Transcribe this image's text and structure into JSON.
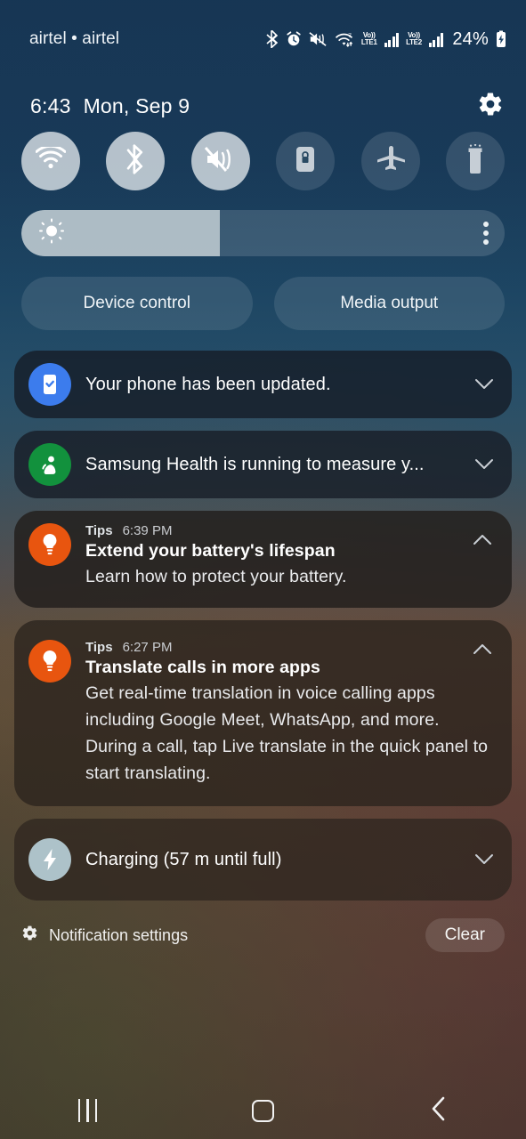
{
  "status_bar": {
    "carrier": "airtel • airtel",
    "battery_percent": "24%",
    "icons": [
      "bluetooth-icon",
      "alarm-icon",
      "mute-vibrate-icon",
      "wifi-icon",
      "volte1-icon",
      "signal-bars-1-icon",
      "volte2-icon",
      "signal-bars-2-icon",
      "battery-charging-icon"
    ],
    "wifi_badge": "7",
    "volte1_top": "Vo))",
    "volte1_bottom": "LTE1",
    "volte2_top": "Vo))",
    "volte2_bottom": "LTE2"
  },
  "header": {
    "time": "6:43",
    "date": "Mon, Sep 9",
    "settings_icon": "gear-icon"
  },
  "quick_toggles": [
    {
      "name": "wifi",
      "label": "Wi-Fi",
      "icon": "wifi-icon",
      "state": "on"
    },
    {
      "name": "bluetooth",
      "label": "Bluetooth",
      "icon": "bluetooth-icon",
      "state": "on"
    },
    {
      "name": "sound-mode",
      "label": "Vibrate",
      "icon": "mute-vibrate-icon",
      "state": "on"
    },
    {
      "name": "auto-rotate",
      "label": "Auto rotate",
      "icon": "rotation-lock-icon",
      "state": "off"
    },
    {
      "name": "airplane-mode",
      "label": "Airplane mode",
      "icon": "airplane-icon",
      "state": "off"
    },
    {
      "name": "flashlight",
      "label": "Flashlight",
      "icon": "flashlight-icon",
      "state": "off"
    }
  ],
  "brightness": {
    "icon": "sun-icon",
    "level_percent": 41,
    "menu_icon": "more-vertical-icon"
  },
  "panel_buttons": {
    "device_control": "Device control",
    "media_output": "Media output"
  },
  "notifications": [
    {
      "app_icon": "software-update-icon",
      "title": "Your phone has been updated.",
      "expanded": false,
      "chevron": "chevron-down-icon"
    },
    {
      "app_icon": "samsung-health-icon",
      "title": "Samsung Health is running to measure y...",
      "expanded": false,
      "chevron": "chevron-down-icon"
    },
    {
      "app_icon": "tips-bulb-icon",
      "app_name": "Tips",
      "time": "6:39 PM",
      "heading": "Extend your battery's lifespan",
      "text": "Learn how to protect your battery.",
      "expanded": true,
      "chevron": "chevron-up-icon"
    },
    {
      "app_icon": "tips-bulb-icon",
      "app_name": "Tips",
      "time": "6:27 PM",
      "heading": "Translate calls in more apps",
      "text": "Get real-time translation in voice calling apps including Google Meet, WhatsApp, and more. During a call, tap Live translate in the quick panel to start translating.",
      "expanded": true,
      "chevron": "chevron-up-icon"
    },
    {
      "app_icon": "charging-bolt-icon",
      "title": "Charging (57 m until full)",
      "expanded": false,
      "chevron": "chevron-down-icon"
    }
  ],
  "footer": {
    "settings_icon": "gear-icon",
    "settings_label": "Notification settings",
    "clear_label": "Clear"
  },
  "nav_bar": {
    "recents": "recents-icon",
    "home": "home-icon",
    "back": "back-icon"
  },
  "colors": {
    "accent_blue": "#3c7ced",
    "accent_green": "#12913d",
    "accent_orange": "#e8550f",
    "accent_grey": "#adc2c9",
    "background_top": "#1d4367",
    "background_bottom": "#463e37"
  }
}
